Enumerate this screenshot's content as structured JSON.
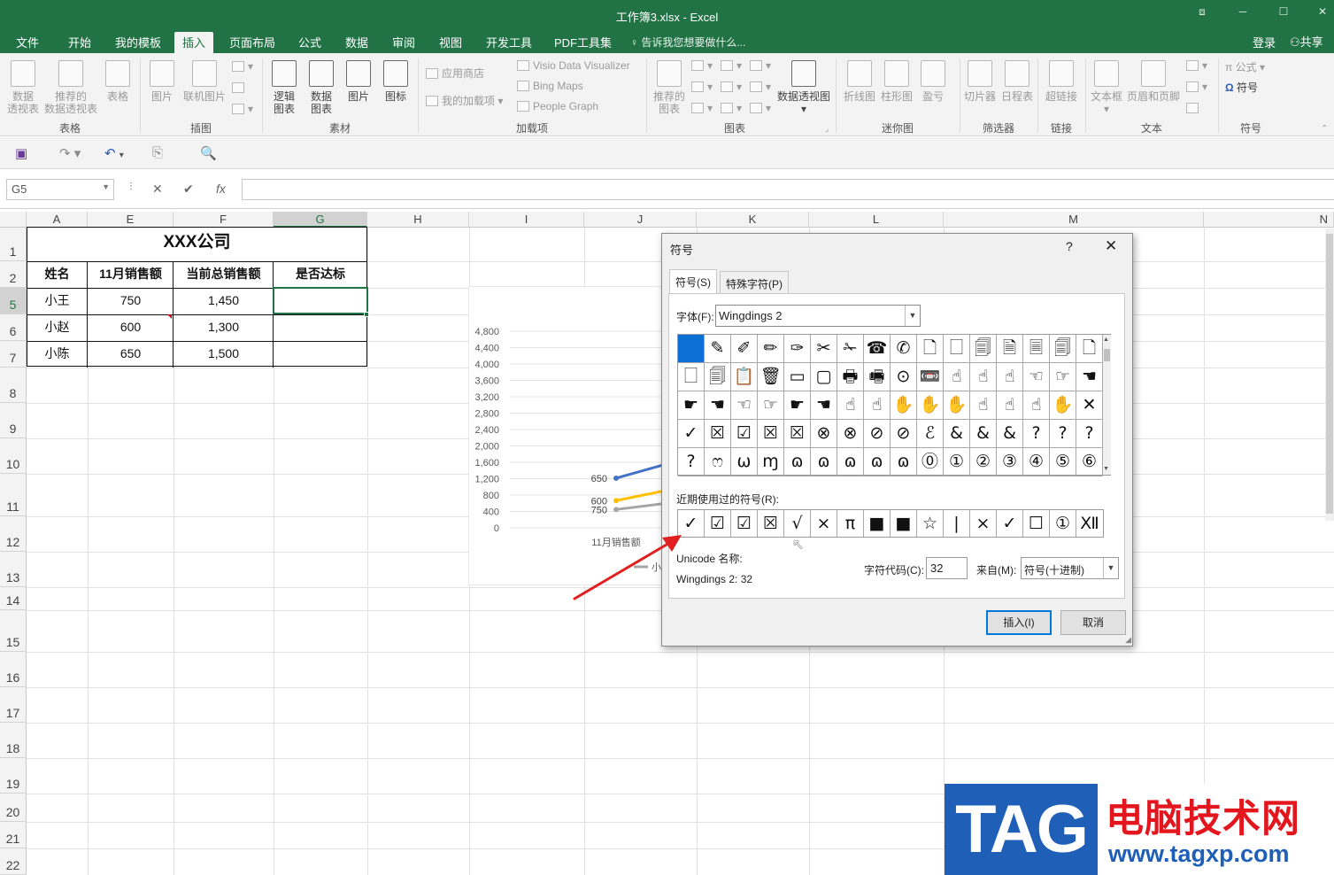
{
  "window": {
    "title": "工作簿3.xlsx - Excel"
  },
  "menu": {
    "tabs": [
      "文件",
      "开始",
      "我的模板",
      "插入",
      "页面布局",
      "公式",
      "数据",
      "审阅",
      "视图",
      "开发工具",
      "PDF工具集"
    ],
    "active": "插入",
    "tell_me": "告诉我您想要做什么...",
    "login": "登录",
    "share": "共享"
  },
  "ribbon": {
    "groups": {
      "table": "表格",
      "illus": "插图",
      "material": "素材",
      "addins": "加载项",
      "charts": "图表",
      "spark": "迷你图",
      "filter": "筛选器",
      "link": "链接",
      "text": "文本",
      "symbol": "符号"
    },
    "buttons": {
      "pivot": "数据\n透视表",
      "rec_pivot": "推荐的\n数据透视表",
      "table": "表格",
      "picture": "图片",
      "online_pic": "联机图片",
      "logic_chart": "逻辑\n图表",
      "data_chart": "数据\n图表",
      "picture2": "图片",
      "icon": "图标",
      "store": "应用商店",
      "my_addins": "我的加载项",
      "visio": "Visio Data Visualizer",
      "bing": "Bing Maps",
      "people": "People Graph",
      "rec_chart": "推荐的\n图表",
      "pivot_chart": "数据透视图",
      "line": "折线图",
      "column": "柱形图",
      "winloss": "盈亏",
      "slicer": "切片器",
      "timeline": "日程表",
      "hyperlink": "超链接",
      "textbox": "文本框",
      "header": "页眉和页脚",
      "equation": "公式",
      "symbol": "符号"
    }
  },
  "formula_bar": {
    "name_box": "G5",
    "fx": "fx",
    "value": ""
  },
  "sheet": {
    "columns": [
      "A",
      "E",
      "F",
      "G",
      "H",
      "I",
      "J",
      "K",
      "L",
      "M",
      "N"
    ],
    "selected_column": "G",
    "rows": [
      "1",
      "2",
      "5",
      "6",
      "7",
      "8",
      "9",
      "10",
      "11",
      "12",
      "13",
      "14",
      "15",
      "16",
      "17",
      "18",
      "19",
      "20",
      "21",
      "22"
    ],
    "selected_row": "5",
    "title": "XXX公司",
    "headers": [
      "姓名",
      "11月销售额",
      "当前总销售额",
      "是否达标"
    ],
    "data": [
      [
        "小王",
        "750",
        "1,450",
        ""
      ],
      [
        "小赵",
        "600",
        "1,300",
        ""
      ],
      [
        "小陈",
        "650",
        "1,500",
        ""
      ]
    ]
  },
  "chart_data": {
    "type": "line",
    "y_ticks": [
      "4,800",
      "4,400",
      "4,000",
      "3,600",
      "3,200",
      "2,800",
      "2,400",
      "2,000",
      "1,600",
      "1,200",
      "800",
      "400",
      "0"
    ],
    "x_label_visible": "11月销售额",
    "ylim": [
      0,
      4800
    ],
    "legend_partial": "小",
    "series": [
      {
        "label": "650",
        "color": "#4472c4",
        "value": 650
      },
      {
        "label": "600",
        "color": "#ffc000",
        "value": 600
      },
      {
        "label": "750",
        "color": "#a5a5a5",
        "value": 750
      }
    ]
  },
  "dialog": {
    "title": "符号",
    "help": "?",
    "close": "✕",
    "tabs": [
      "符号(S)",
      "特殊字符(P)"
    ],
    "font_label": "字体(F):",
    "font_value": "Wingdings 2",
    "symbols": [
      [
        "",
        "✎",
        "✐",
        "✏",
        "✑",
        "✂",
        "✁",
        "☎",
        "✆",
        "🗋",
        "🗌",
        "🗐",
        "🗎",
        "🗏",
        "🗐",
        "🗋"
      ],
      [
        "🗌",
        "🗐",
        "📋",
        "🗑",
        "▭",
        "▢",
        "🖶",
        "🖷",
        "⊙",
        "📼",
        "☝",
        "☝",
        "☝",
        "☜",
        "☞",
        "☚"
      ],
      [
        "☛",
        "☚",
        "☜",
        "☞",
        "☛",
        "☚",
        "☝",
        "☝",
        "✋",
        "✋",
        "✋",
        "☝",
        "☝",
        "☝",
        "✋",
        "✕"
      ],
      [
        "✓",
        "☒",
        "☑",
        "☒",
        "☒",
        "⊗",
        "⊗",
        "⊘",
        "⊘",
        "ℰ",
        "&",
        "&",
        "&",
        "?",
        "?",
        "?"
      ],
      [
        "?",
        "ෆ",
        "ω",
        "ɱ",
        "ɷ",
        "ɷ",
        "ɷ",
        "ɷ",
        "ɷ",
        "⓪",
        "①",
        "②",
        "③",
        "④",
        "⑤",
        "⑥"
      ]
    ],
    "recent_label": "近期使用过的符号(R):",
    "recent": [
      "✓",
      "☑",
      "☑",
      "☒",
      "√",
      "×",
      "π",
      "■",
      "■",
      "☆",
      "|",
      "×",
      "✓",
      "☐",
      "①",
      "Ⅻ"
    ],
    "unicode_name_label": "Unicode 名称:",
    "unicode_value": "Wingdings 2: 32",
    "char_code_label": "字符代码(C):",
    "char_code": "32",
    "from_label": "来自(M):",
    "from_value": "符号(十进制)",
    "insert": "插入(I)",
    "cancel": "取消"
  },
  "watermark": {
    "tag": "TAG",
    "site_name": "电脑技术网",
    "url": "www.tagxp.com"
  },
  "colors": {
    "excel_green": "#217346",
    "selection_blue": "#0b6fd6",
    "annotation_arrow": "#e02020"
  }
}
